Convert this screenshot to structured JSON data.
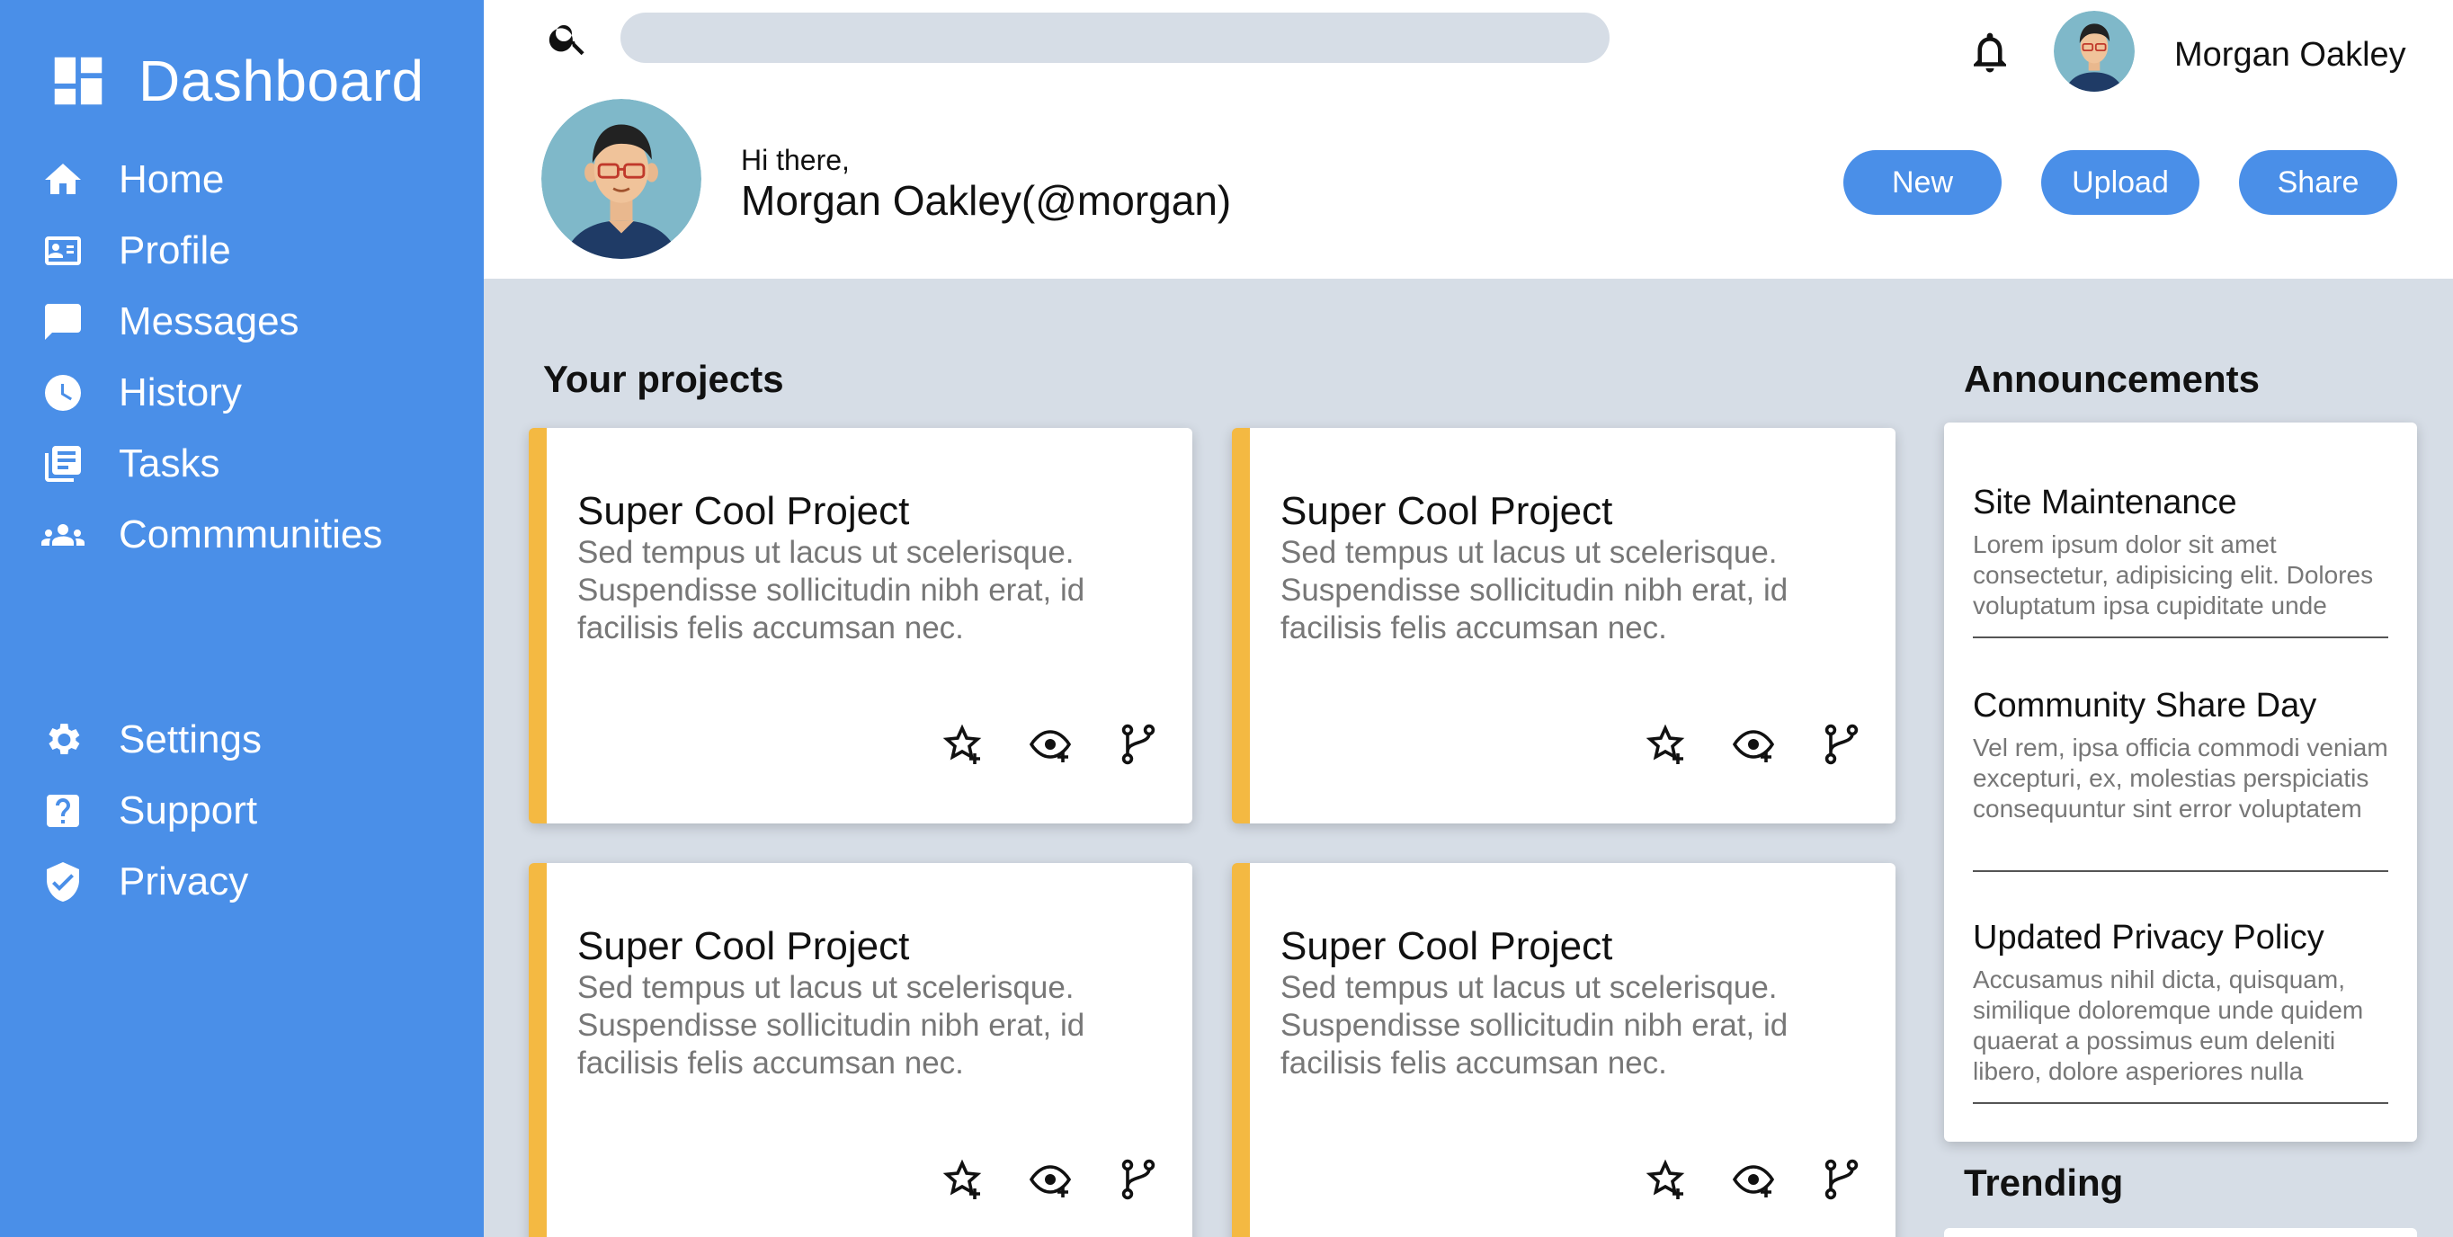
{
  "sidebar": {
    "brand": "Dashboard",
    "primary": [
      {
        "label": "Home",
        "icon": "home-icon"
      },
      {
        "label": "Profile",
        "icon": "profile-card-icon"
      },
      {
        "label": "Messages",
        "icon": "message-icon"
      },
      {
        "label": "History",
        "icon": "clock-icon"
      },
      {
        "label": "Tasks",
        "icon": "tasks-icon"
      },
      {
        "label": "Commmunities",
        "icon": "people-icon"
      }
    ],
    "secondary": [
      {
        "label": "Settings",
        "icon": "gear-icon"
      },
      {
        "label": "Support",
        "icon": "help-icon"
      },
      {
        "label": "Privacy",
        "icon": "shield-icon"
      }
    ]
  },
  "header": {
    "search": {
      "placeholder": "",
      "value": ""
    },
    "user_name": "Morgan Oakley",
    "greeting_small": "Hi there,",
    "greeting_name": "Morgan Oakley(@morgan)",
    "buttons": {
      "new": "New",
      "upload": "Upload",
      "share": "Share"
    }
  },
  "main": {
    "projects_title": "Your projects",
    "projects": [
      {
        "title": "Super Cool Project",
        "desc": "Sed tempus ut lacus ut scelerisque. Suspendisse sollicitudin nibh erat, id facilisis felis accumsan nec."
      },
      {
        "title": "Super Cool Project",
        "desc": "Sed tempus ut lacus ut scelerisque. Suspendisse sollicitudin nibh erat, id facilisis felis accumsan nec."
      },
      {
        "title": "Super Cool Project",
        "desc": "Sed tempus ut lacus ut scelerisque. Suspendisse sollicitudin nibh erat, id facilisis felis accumsan nec."
      },
      {
        "title": "Super Cool Project",
        "desc": "Sed tempus ut lacus ut scelerisque. Suspendisse sollicitudin nibh erat, id facilisis felis accumsan nec."
      }
    ],
    "announcements_title": "Announcements",
    "announcements": [
      {
        "title": "Site Maintenance",
        "body": "Lorem ipsum dolor sit amet consectetur, adipisicing elit. Dolores voluptatum ipsa cupiditate unde"
      },
      {
        "title": "Community Share Day",
        "body": "Vel rem, ipsa officia commodi veniam excepturi, ex, molestias perspiciatis consequuntur sint error voluptatem"
      },
      {
        "title": "Updated Privacy Policy",
        "body": "Accusamus nihil dicta, quisquam, similique doloremque unde quidem quaerat a possimus eum deleniti libero, dolore asperiores nulla"
      }
    ],
    "trending_title": "Trending"
  },
  "colors": {
    "accent": "#4a8fe8",
    "card_stripe": "#f4b942",
    "page_bg": "#d6dde6"
  }
}
